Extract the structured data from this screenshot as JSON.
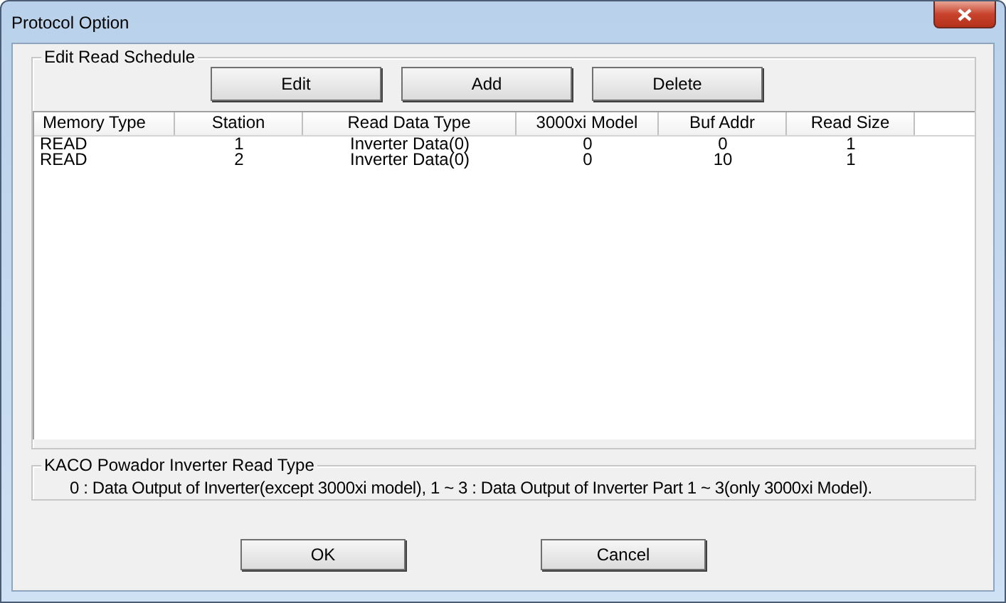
{
  "window": {
    "title": "Protocol Option"
  },
  "schedule": {
    "title": "Edit Read Schedule",
    "buttons": [
      "Edit",
      "Add",
      "Delete"
    ],
    "columns": [
      "Memory Type",
      "Station",
      "Read Data Type",
      "3000xi Model",
      "Buf Addr",
      "Read Size"
    ],
    "rows": [
      [
        "READ",
        "1",
        "Inverter Data(0)",
        "0",
        "0",
        "1"
      ],
      [
        "READ",
        "2",
        "Inverter Data(0)",
        "0",
        "10",
        "1"
      ]
    ]
  },
  "read_type": {
    "title": "KACO Powador Inverter Read Type",
    "text": "0 : Data Output of Inverter(except 3000xi model),  1  ~ 3 : Data Output of Inverter Part 1 ~ 3(only 3000xi Model)."
  },
  "buttons": [
    "OK",
    "Cancel"
  ]
}
